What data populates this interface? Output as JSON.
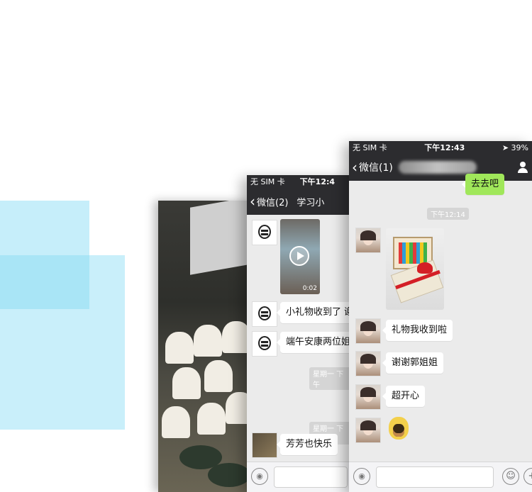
{
  "mid_phone": {
    "status": {
      "carrier": "无 SIM 卡",
      "time": "下午12:4"
    },
    "nav": {
      "back_label": "微信(2)",
      "title": "学习小"
    },
    "video": {
      "duration": "0:02"
    },
    "messages": [
      "小礼物收到了  谢",
      "端午安康两位姐"
    ],
    "timestamps": [
      "星期一  下午",
      "星期一  下午"
    ],
    "last_message": "芳芳也快乐",
    "input": {
      "voice_icon": "voice-icon"
    }
  },
  "front_phone": {
    "status": {
      "carrier": "无 SIM 卡",
      "time": "下午12:43",
      "battery": "39%"
    },
    "nav": {
      "back_label": "微信(1)",
      "person_icon": "person-icon"
    },
    "top_bubble": "去去吧",
    "timestamp": "下午12:14",
    "messages": [
      "礼物我收到啦",
      "谢谢郭姐姐",
      "超开心"
    ],
    "input": {
      "voice_icon": "voice-icon",
      "emoji_icon": "emoji-icon",
      "plus_icon": "plus-icon"
    }
  },
  "colors": {
    "accent_blue": "#c6eefa",
    "bubble_green": "#a0e75a",
    "bar_dark": "#2c2c2f"
  }
}
